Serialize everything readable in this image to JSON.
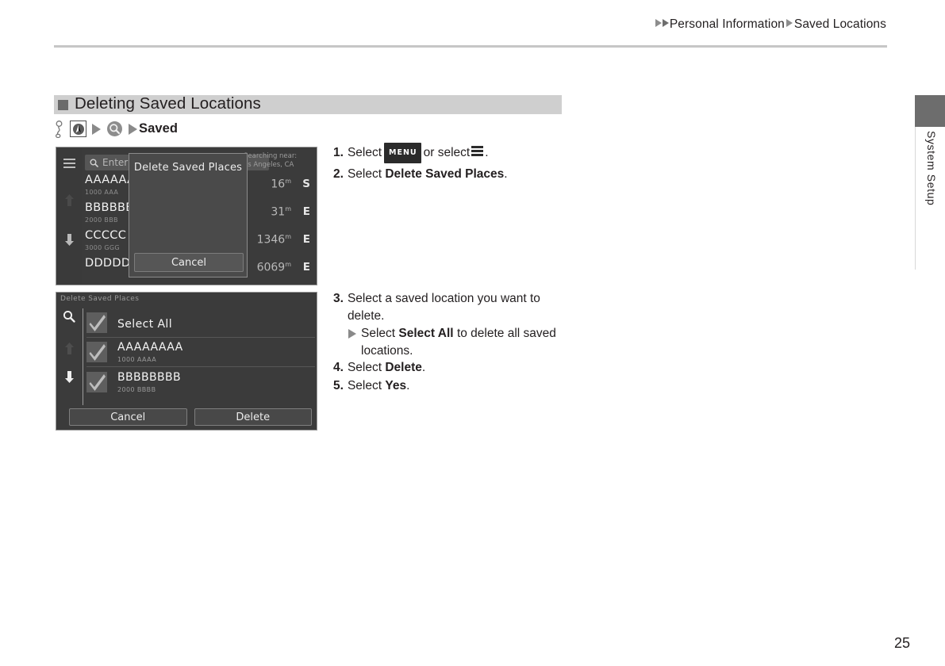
{
  "breadcrumb": {
    "item1": "Personal Information",
    "item2": "Saved Locations"
  },
  "side_tab": {
    "label": "System Setup"
  },
  "section": {
    "heading": "Deleting Saved Locations"
  },
  "path": {
    "destination": "Saved"
  },
  "steps_top": [
    {
      "num": "1.",
      "pre": "Select",
      "badge": "MENU",
      "mid": "or select",
      "post": "."
    },
    {
      "num": "2.",
      "pre": "Select",
      "bold": "Delete Saved Places",
      "post": "."
    }
  ],
  "steps_bottom": {
    "step3": {
      "num": "3.",
      "text": "Select a saved location you want to delete."
    },
    "sub3": {
      "pre": "Select",
      "bold": "Select All",
      "post": "to delete all saved locations."
    },
    "step4": {
      "num": "4.",
      "pre": "Select",
      "bold": "Delete",
      "post": "."
    },
    "step5": {
      "num": "5.",
      "pre": "Select",
      "bold": "Yes",
      "post": "."
    }
  },
  "screenshot1": {
    "search_placeholder": "Enter",
    "searching_near_label": "Searching near:",
    "searching_near_value": "os Angeles, CA",
    "rows": [
      {
        "name": "AAAAAA",
        "address": "1000 AAA",
        "dist": "16",
        "unit": "m",
        "dir": "S"
      },
      {
        "name": "BBBBBB",
        "address": "2000 BBB",
        "dist": "31",
        "unit": "m",
        "dir": "E"
      },
      {
        "name": "CCCCC",
        "address": "3000 GGG",
        "dist": "1346",
        "unit": "m",
        "dir": "E"
      },
      {
        "name": "DDDDD",
        "address": "",
        "dist": "6069",
        "unit": "m",
        "dir": "E"
      }
    ],
    "dialog": {
      "title": "Delete Saved Places",
      "cancel": "Cancel"
    }
  },
  "screenshot2": {
    "title": "Delete Saved Places",
    "items": [
      {
        "name": "Select All",
        "address": ""
      },
      {
        "name": "AAAAAAAA",
        "address": "1000 AAAA"
      },
      {
        "name": "BBBBBBBB",
        "address": "2000 BBBB"
      }
    ],
    "cancel": "Cancel",
    "delete": "Delete"
  },
  "page_number": "25"
}
